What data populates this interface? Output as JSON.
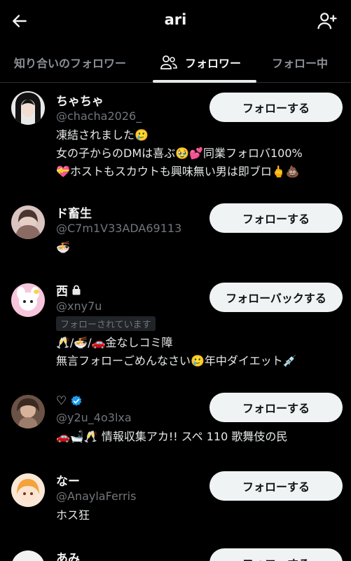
{
  "header": {
    "title": "ari",
    "back_icon": "arrow-left-icon",
    "add_icon": "add-user-icon"
  },
  "tabs": [
    {
      "label": "知り合いのフォロワー",
      "active": false
    },
    {
      "label": "フォロワー",
      "active": true,
      "icon": "people-icon"
    },
    {
      "label": "フォロー中",
      "active": false
    }
  ],
  "users": [
    {
      "name": "ちゃちゃ",
      "handle": "@chacha2026_",
      "button": "フォローする",
      "bio": [
        "凍結されました🥲",
        "女の子からのDMは喜ぶ🥹💕同業フォロバ100%",
        "💝ホストもスカウトも興味無い男は即ブロ🖕💩"
      ]
    },
    {
      "name": "ド畜生",
      "handle": "@C7m1V33ADA69113",
      "button": "フォローする",
      "bio": [
        "🍜"
      ]
    },
    {
      "name": "西",
      "handle": "@xny7u",
      "button": "フォローバックする",
      "follows_you": "フォローされています",
      "locked_icon": "lock-icon",
      "bio": [
        "🥂/🍜/🚗金なしコミ障",
        "無言フォローごめんなさい🥲年中ダイエット💉"
      ]
    },
    {
      "name": "♡",
      "handle": "@y2u_4o3lxa",
      "button": "フォローする",
      "verified_icon": "verified-badge-icon",
      "bio": [
        "🚗🛁🥂 情報収集アカ!! スペ 110 歌舞伎の民"
      ]
    },
    {
      "name": "なー",
      "handle": "@AnaylaFerris",
      "button": "フォローする",
      "bio": [
        "ホス狂"
      ]
    },
    {
      "name": "あみ",
      "handle": "",
      "button": "フォローする",
      "bio": []
    }
  ],
  "colors": {
    "background": "#000000",
    "button_bg": "#eff3f4",
    "muted": "#71767b",
    "verified": "#1d9bf0"
  }
}
